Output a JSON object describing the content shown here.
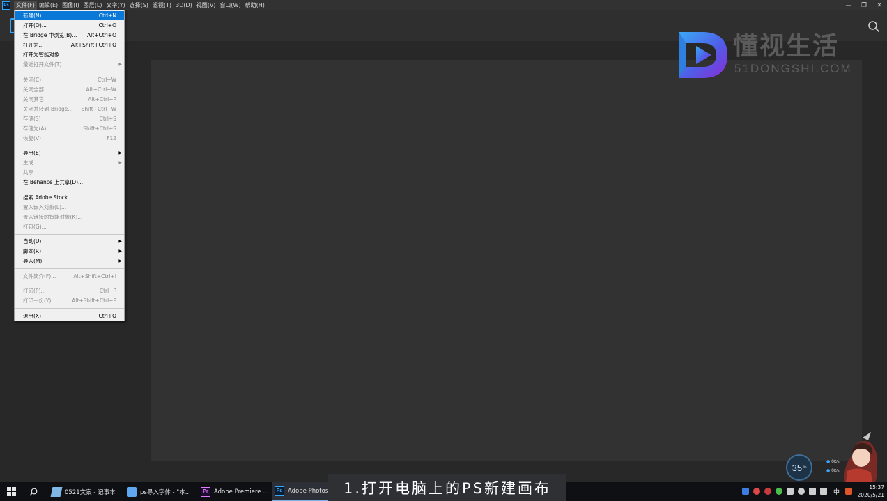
{
  "app": {
    "badge": "Ps",
    "menus": [
      "文件(F)",
      "编辑(E)",
      "图像(I)",
      "图层(L)",
      "文字(Y)",
      "选择(S)",
      "滤镜(T)",
      "3D(D)",
      "视图(V)",
      "窗口(W)",
      "帮助(H)"
    ],
    "window_controls": {
      "minimize": "—",
      "restore": "❐",
      "close": "✕"
    }
  },
  "file_menu": {
    "items": [
      {
        "label": "新建(N)...",
        "shortcut": "Ctrl+N",
        "state": "highlighted"
      },
      {
        "label": "打开(O)...",
        "shortcut": "Ctrl+O",
        "state": "enabled"
      },
      {
        "label": "在 Bridge 中浏览(B)...",
        "shortcut": "Alt+Ctrl+O",
        "state": "enabled"
      },
      {
        "label": "打开为...",
        "shortcut": "Alt+Shift+Ctrl+O",
        "state": "enabled"
      },
      {
        "label": "打开为智能对象...",
        "shortcut": "",
        "state": "enabled"
      },
      {
        "label": "最近打开文件(T)",
        "shortcut": "",
        "state": "disabled",
        "submenu": true
      },
      {
        "separator": true
      },
      {
        "label": "关闭(C)",
        "shortcut": "Ctrl+W",
        "state": "disabled"
      },
      {
        "label": "关闭全部",
        "shortcut": "Alt+Ctrl+W",
        "state": "disabled"
      },
      {
        "label": "关闭其它",
        "shortcut": "Alt+Ctrl+P",
        "state": "disabled"
      },
      {
        "label": "关闭并转到 Bridge...",
        "shortcut": "Shift+Ctrl+W",
        "state": "disabled"
      },
      {
        "label": "存储(S)",
        "shortcut": "Ctrl+S",
        "state": "disabled"
      },
      {
        "label": "存储为(A)...",
        "shortcut": "Shift+Ctrl+S",
        "state": "disabled"
      },
      {
        "label": "恢复(V)",
        "shortcut": "F12",
        "state": "disabled"
      },
      {
        "separator": true
      },
      {
        "label": "导出(E)",
        "shortcut": "",
        "state": "enabled",
        "submenu": true
      },
      {
        "label": "生成",
        "shortcut": "",
        "state": "disabled",
        "submenu": true
      },
      {
        "label": "共享...",
        "shortcut": "",
        "state": "disabled"
      },
      {
        "label": "在 Behance 上共享(D)...",
        "shortcut": "",
        "state": "enabled"
      },
      {
        "separator": true
      },
      {
        "label": "搜索 Adobe Stock...",
        "shortcut": "",
        "state": "enabled"
      },
      {
        "label": "置入嵌入对象(L)...",
        "shortcut": "",
        "state": "disabled"
      },
      {
        "label": "置入链接的智能对象(K)...",
        "shortcut": "",
        "state": "disabled"
      },
      {
        "label": "打包(G)...",
        "shortcut": "",
        "state": "disabled"
      },
      {
        "separator": true
      },
      {
        "label": "自动(U)",
        "shortcut": "",
        "state": "enabled",
        "submenu": true
      },
      {
        "label": "脚本(R)",
        "shortcut": "",
        "state": "enabled",
        "submenu": true
      },
      {
        "label": "导入(M)",
        "shortcut": "",
        "state": "enabled",
        "submenu": true
      },
      {
        "separator": true
      },
      {
        "label": "文件简介(F)...",
        "shortcut": "Alt+Shift+Ctrl+I",
        "state": "disabled"
      },
      {
        "separator": true
      },
      {
        "label": "打印(P)...",
        "shortcut": "Ctrl+P",
        "state": "disabled"
      },
      {
        "label": "打印一份(Y)",
        "shortcut": "Alt+Shift+Ctrl+P",
        "state": "disabled"
      },
      {
        "separator": true
      },
      {
        "label": "退出(X)",
        "shortcut": "Ctrl+Q",
        "state": "enabled"
      }
    ]
  },
  "watermark": {
    "title": "懂视生活",
    "url": "51DONGSHI.COM"
  },
  "caption": "1.打开电脑上的PS新建画布",
  "taskbar": {
    "apps": [
      {
        "label": "0521文案 - 记事本",
        "icon": "notepad-icon"
      },
      {
        "label": "ps导入字体 - \"本...",
        "icon": "document-icon"
      },
      {
        "label": "Adobe Premiere ...",
        "icon": "premiere-icon",
        "badge": "Pr"
      },
      {
        "label": "Adobe Photosh",
        "icon": "photoshop-icon",
        "badge": "Ps",
        "active": true
      }
    ],
    "ime": "中",
    "time": "15:37",
    "date": "2020/5/21"
  },
  "speed_widget": {
    "percent": "35",
    "unit": "%",
    "up": "0",
    "down": "0",
    "rate_unit": "K/s"
  },
  "colors": {
    "accent": "#0a78d7",
    "ps_blue": "#31a8ff",
    "menu_bg": "#f0f0f0",
    "workspace": "#282828"
  }
}
